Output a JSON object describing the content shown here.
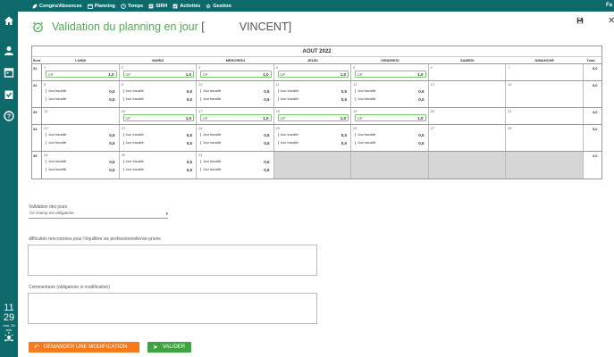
{
  "topbar": {
    "items": [
      {
        "label": "Congés/Absences",
        "icon": "leaf-icon"
      },
      {
        "label": "Planning",
        "icon": "calendar-icon"
      },
      {
        "label": "Temps",
        "icon": "clock-icon"
      },
      {
        "label": "SIRH",
        "icon": "sirh-icon"
      },
      {
        "label": "Activités",
        "icon": "check-icon"
      },
      {
        "label": "Gestion",
        "icon": "gear-icon"
      }
    ],
    "right_text": "Fa"
  },
  "sidebar": {
    "clock_hour": "11",
    "clock_min": "29",
    "clock_date": "mar. 30",
    "clock_date2": "aoû"
  },
  "title": {
    "prefix": "Validation du planning en jour",
    "bracket_open": "[",
    "name": "VINCENT]"
  },
  "calendar": {
    "month": "AOUT 2022",
    "headers": {
      "sem": "Sem.",
      "days": [
        "LUNDI",
        "MARDI",
        "MERCREDI",
        "JEUDI",
        "VENDREDI",
        "SAMEDI",
        "DIMANCHE"
      ],
      "total": "Total"
    },
    "weeks": [
      {
        "sem": "31",
        "total": "5,0",
        "cells": [
          {
            "num": "1",
            "type": "cp",
            "label": "CP",
            "value": "1,0"
          },
          {
            "num": "2",
            "type": "cp",
            "label": "CP",
            "value": "1,0"
          },
          {
            "num": "3",
            "type": "cp",
            "label": "CP",
            "value": "1,0"
          },
          {
            "num": "4",
            "type": "cp",
            "label": "CP",
            "value": "1,0"
          },
          {
            "num": "5",
            "type": "cp",
            "label": "CP",
            "value": "1,0"
          },
          {
            "num": "6",
            "type": "we"
          },
          {
            "num": "7",
            "type": "we"
          }
        ]
      },
      {
        "sem": "32",
        "total": "5,0",
        "cells": [
          {
            "num": "8",
            "type": "jt",
            "label": "Jour travaillé",
            "values": [
              "0,5",
              "0,5"
            ]
          },
          {
            "num": "9",
            "type": "jt",
            "label": "Jour travaillé",
            "values": [
              "0,5",
              "0,5"
            ]
          },
          {
            "num": "10",
            "type": "jt",
            "label": "Jour travaillé",
            "values": [
              "0,5",
              "0,5"
            ]
          },
          {
            "num": "11",
            "type": "jt",
            "label": "Jour travaillé",
            "values": [
              "0,5",
              "0,5"
            ]
          },
          {
            "num": "12",
            "type": "jt",
            "label": "Jour travaillé",
            "values": [
              "0,5",
              "0,5"
            ]
          },
          {
            "num": "13",
            "type": "we"
          },
          {
            "num": "14",
            "type": "we"
          }
        ]
      },
      {
        "sem": "33",
        "total": "4,0",
        "cells": [
          {
            "num": "15",
            "type": "empty"
          },
          {
            "num": "16",
            "type": "cp",
            "label": "CP",
            "value": "1,0"
          },
          {
            "num": "17",
            "type": "cp",
            "label": "CP",
            "value": "1,0"
          },
          {
            "num": "18",
            "type": "cp",
            "label": "CP",
            "value": "1,0"
          },
          {
            "num": "19",
            "type": "cp",
            "label": "CP",
            "value": "1,0"
          },
          {
            "num": "20",
            "type": "we"
          },
          {
            "num": "21",
            "type": "we"
          }
        ]
      },
      {
        "sem": "34",
        "total": "5,0",
        "cells": [
          {
            "num": "22",
            "type": "jt",
            "label": "Jour travaillé",
            "values": [
              "0,5",
              "0,5"
            ]
          },
          {
            "num": "23",
            "type": "jt",
            "label": "Jour travaillé",
            "values": [
              "0,5",
              "0,5"
            ]
          },
          {
            "num": "24",
            "type": "jt",
            "label": "Jour travaillé",
            "values": [
              "0,5",
              "0,5"
            ]
          },
          {
            "num": "25",
            "type": "jt",
            "label": "Jour travaillé",
            "values": [
              "0,5",
              "0,5"
            ]
          },
          {
            "num": "26",
            "type": "jt",
            "label": "Jour travaillé",
            "values": [
              "0,5",
              "0,5"
            ]
          },
          {
            "num": "27",
            "type": "we"
          },
          {
            "num": "28",
            "type": "we"
          }
        ]
      },
      {
        "sem": "35",
        "total": "3,0",
        "cells": [
          {
            "num": "29",
            "type": "jt",
            "label": "Jour travaillé",
            "values": [
              "0,5",
              "0,5"
            ]
          },
          {
            "num": "30",
            "type": "jt",
            "label": "Jour travaillé",
            "values": [
              "0,5",
              "0,5"
            ]
          },
          {
            "num": "31",
            "type": "jt",
            "label": "Jour travaillé",
            "values": [
              "0,5",
              "0,5"
            ]
          },
          {
            "num": "",
            "type": "gray"
          },
          {
            "num": "",
            "type": "gray"
          },
          {
            "num": "",
            "type": "gray"
          },
          {
            "num": "",
            "type": "gray"
          }
        ]
      }
    ]
  },
  "form": {
    "validation_label": "Validation des jours",
    "validation_value": "Ce champ est obligatoire",
    "difficultes_label": "difficultés rencontrées pour l'équilibre vie professionnelle/vie privée",
    "commentaire_label": "Commentaire (obligatoire si modification)"
  },
  "buttons": {
    "modify": "DEMANDER UNE MODIFICATION",
    "validate": "VALIDER"
  },
  "colors": {
    "teal": "#0e6a6a",
    "green": "#4caf50",
    "orange": "#f37b1d"
  }
}
